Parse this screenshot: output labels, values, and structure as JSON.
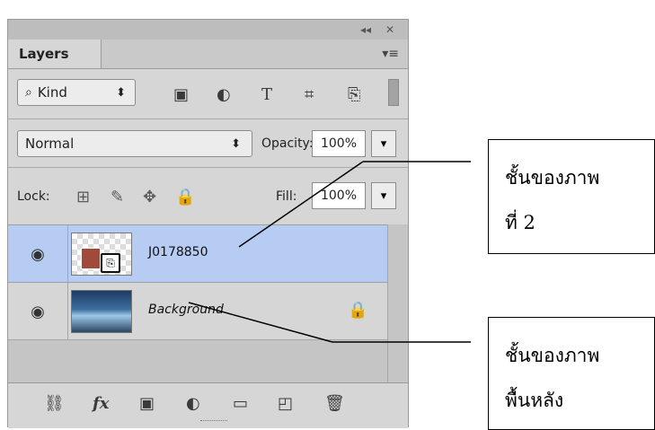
{
  "panel": {
    "title": "Layers",
    "top_buttons": {
      "collapse": "◂◂",
      "close": "✕"
    },
    "menu_icon": "panel-menu-icon",
    "filter": {
      "kind_label": "Kind",
      "icons": [
        "image-filter-icon",
        "adjustment-filter-icon",
        "type-filter-icon",
        "shape-filter-icon",
        "smartobject-filter-icon"
      ]
    },
    "blend": {
      "mode": "Normal",
      "opacity_label": "Opacity:",
      "opacity_value": "100%"
    },
    "lock": {
      "label": "Lock:",
      "fill_label": "Fill:",
      "fill_value": "100%"
    },
    "layers": [
      {
        "name": "J0178850",
        "selected": true
      },
      {
        "name": "Background",
        "locked": true
      }
    ]
  },
  "annotations": [
    {
      "line1": "ชั้นของภาพ",
      "line2": "ที่ 2"
    },
    {
      "line1": "ชั้นของภาพ",
      "line2": "พื้นหลัง"
    }
  ]
}
